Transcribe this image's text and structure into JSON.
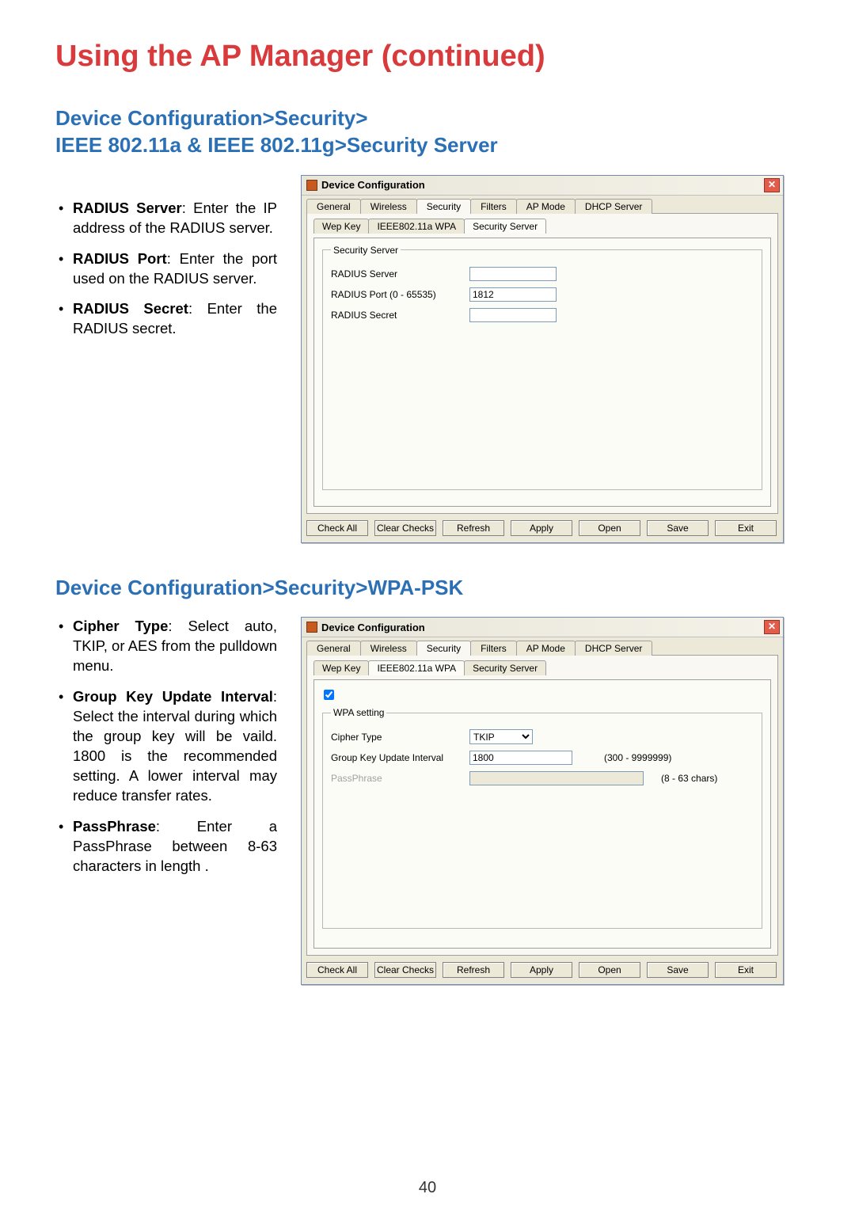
{
  "page": {
    "title": "Using the AP Manager (continued)",
    "number": "40"
  },
  "section1": {
    "heading_line1": "Device Configuration>Security>",
    "heading_line2": "IEEE 802.11a & IEEE 802.11g>Security Server",
    "bullets": [
      {
        "term": "RADIUS Server",
        "desc": ": Enter the IP address of the RADIUS server."
      },
      {
        "term": "RADIUS Port",
        "desc": ": Enter the port used on the RADIUS server."
      },
      {
        "term": "RADIUS Secret",
        "desc": ": Enter the RADIUS secret."
      }
    ]
  },
  "section2": {
    "heading": "Device Configuration>Security>WPA-PSK",
    "bullets": [
      {
        "term": "Cipher Type",
        "desc": ": Select auto, TKIP, or AES from the pulldown menu."
      },
      {
        "term": "Group Key Update Interval",
        "desc": ": Select the interval during which the group key will be vaild. 1800 is the recommended setting. A lower interval may reduce transfer rates."
      },
      {
        "term": "PassPhrase",
        "desc": ": Enter a PassPhrase between 8-63 characters in length ."
      }
    ]
  },
  "dialog": {
    "title": "Device Configuration",
    "tabs": [
      "General",
      "Wireless",
      "Security",
      "Filters",
      "AP Mode",
      "DHCP Server"
    ],
    "sub_tabs": [
      "Wep Key",
      "IEEE802.11a WPA",
      "Security Server"
    ],
    "buttons": [
      "Check All",
      "Clear Checks",
      "Refresh",
      "Apply",
      "Open",
      "Save",
      "Exit"
    ]
  },
  "security_server": {
    "legend": "Security Server",
    "radius_server_label": "RADIUS Server",
    "radius_server_value": "",
    "radius_port_label": "RADIUS Port (0 - 65535)",
    "radius_port_value": "1812",
    "radius_secret_label": "RADIUS Secret",
    "radius_secret_value": ""
  },
  "wpa": {
    "legend": "WPA setting",
    "cipher_label": "Cipher Type",
    "cipher_value": "TKIP",
    "interval_label": "Group Key Update Interval",
    "interval_value": "1800",
    "interval_hint": "(300 - 9999999)",
    "pass_label": "PassPhrase",
    "pass_value": "",
    "pass_hint": "(8 - 63 chars)"
  }
}
